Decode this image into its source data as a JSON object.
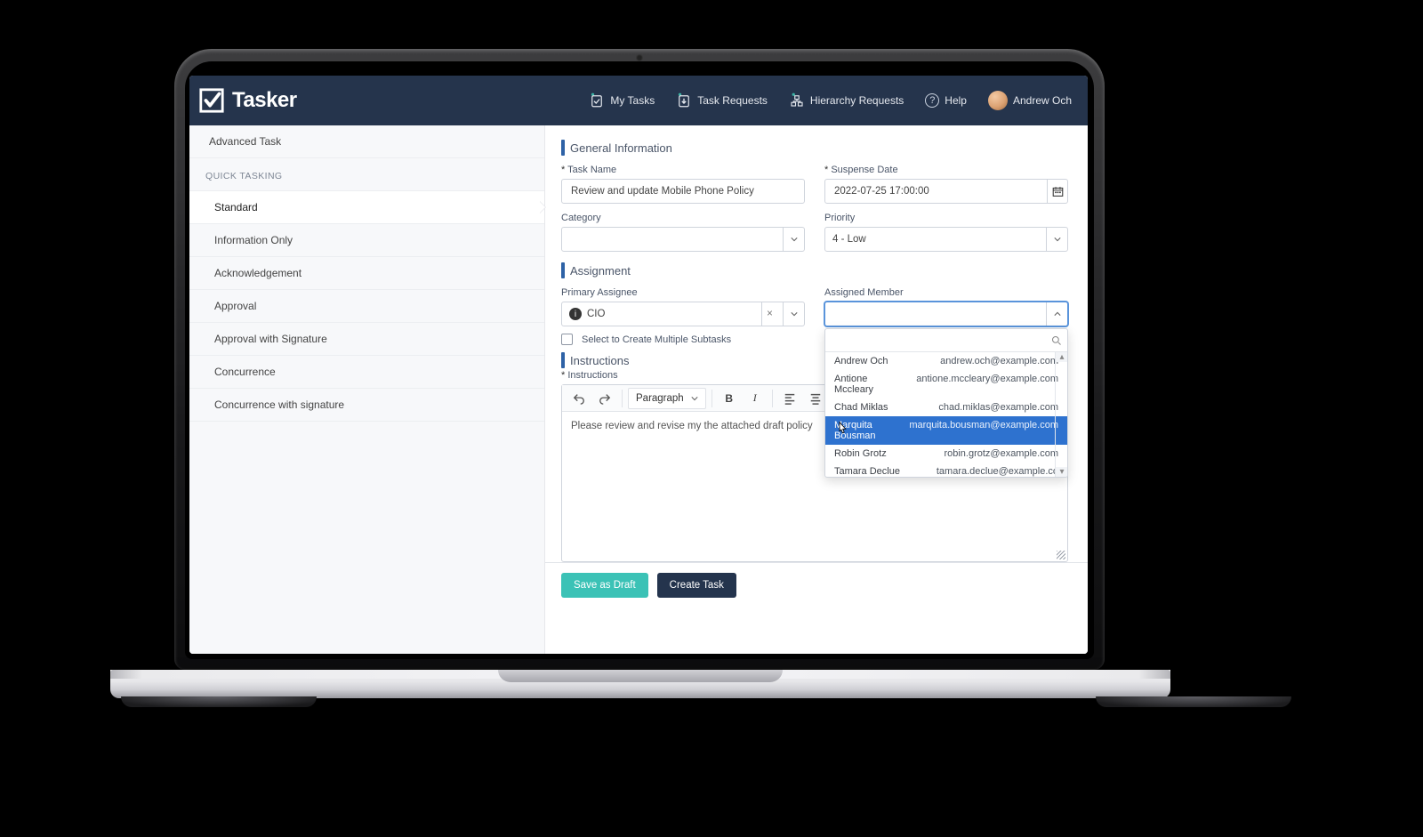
{
  "brand": {
    "name": "Tasker"
  },
  "nav": {
    "my_tasks": "My Tasks",
    "task_requests": "Task Requests",
    "hierarchy_requests": "Hierarchy Requests",
    "help": "Help",
    "user_name": "Andrew Och"
  },
  "sidebar": {
    "top_item": "Advanced Task",
    "heading": "QUICK TASKING",
    "items": [
      "Standard",
      "Information Only",
      "Acknowledgement",
      "Approval",
      "Approval with Signature",
      "Concurrence",
      "Concurrence with signature"
    ],
    "active_index": 0
  },
  "form": {
    "section_general": "General Information",
    "task_name_label": "Task Name",
    "task_name_value": "Review and update Mobile Phone Policy",
    "suspense_label": "Suspense Date",
    "suspense_value": "2022-07-25 17:00:00",
    "category_label": "Category",
    "category_value": "",
    "priority_label": "Priority",
    "priority_value": "4 - Low",
    "section_assignment": "Assignment",
    "primary_assignee_label": "Primary Assignee",
    "primary_assignee_value": "CIO",
    "assigned_member_label": "Assigned Member",
    "assigned_member_value": "",
    "multiple_subtasks_label": "Select to Create Multiple Subtasks",
    "section_instructions": "Instructions",
    "instructions_label": "Instructions",
    "toolbar_paragraph": "Paragraph",
    "instructions_value": "Please review and revise my the attached draft policy"
  },
  "dropdown": {
    "search_value": "",
    "highlight_index": 3,
    "options": [
      {
        "name": "Andrew Och",
        "email": "andrew.och@example.com"
      },
      {
        "name": "Antione Mccleary",
        "email": "antione.mccleary@example.com"
      },
      {
        "name": "Chad Miklas",
        "email": "chad.miklas@example.com"
      },
      {
        "name": "Marquita Bousman",
        "email": "marquita.bousman@example.com"
      },
      {
        "name": "Robin Grotz",
        "email": "robin.grotz@example.com"
      },
      {
        "name": "Tamara Declue",
        "email": "tamara.declue@example.co"
      }
    ]
  },
  "footer": {
    "save_draft": "Save as Draft",
    "create_task": "Create Task"
  }
}
